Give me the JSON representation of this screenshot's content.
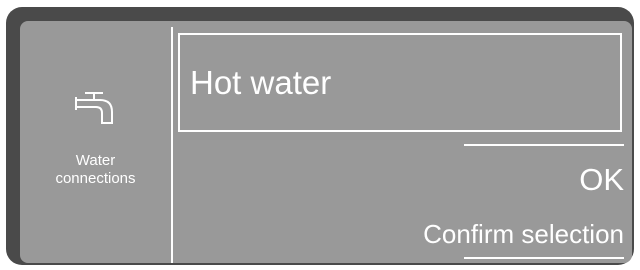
{
  "sidebar": {
    "icon": "water-tap-icon",
    "label": "Water\nconnections"
  },
  "main": {
    "selected_option": "Hot water",
    "ok_label": "OK",
    "ok_hint": "Confirm selection"
  },
  "colors": {
    "display_background": "#999999",
    "bezel": "#4a4a4a",
    "foreground": "#ffffff"
  }
}
